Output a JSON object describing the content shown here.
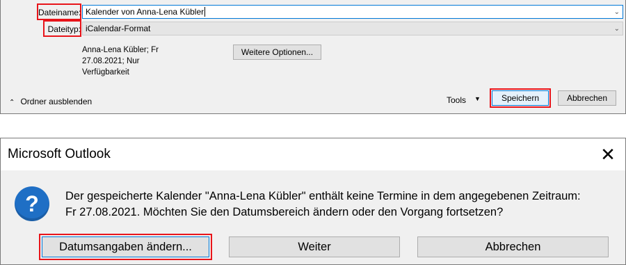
{
  "save_dialog": {
    "filename_label": "Dateiname:",
    "filename_value": "Kalender von Anna-Lena Kübler",
    "filetype_label": "Dateityp:",
    "filetype_value": "iCalendar-Format",
    "calendar_info": [
      "Anna-Lena Kübler; Fr",
      "27.08.2021; Nur",
      "Verfügbarkeit"
    ],
    "more_options": "Weitere Optionen...",
    "hide_folders": "Ordner ausblenden",
    "tools": "Tools",
    "save": "Speichern",
    "cancel": "Abbrechen"
  },
  "message_dialog": {
    "title": "Microsoft Outlook",
    "close_glyph": "✕",
    "icon_glyph": "?",
    "message_lines": [
      "Der gespeicherte Kalender \"Anna-Lena Kübler\" enthält keine Termine in dem angegebenen Zeitraum:",
      "Fr 27.08.2021. Möchten Sie den Datumsbereich ändern oder den Vorgang fortsetzen?"
    ],
    "buttons": {
      "change_dates": "Datumsangaben ändern...",
      "continue": "Weiter",
      "cancel": "Abbrechen"
    }
  },
  "colors": {
    "highlight": "#e8141a",
    "dialog_bg": "#f0f0f0",
    "icon_blue": "#1f6fc5",
    "focus_blue": "#0078d7"
  }
}
